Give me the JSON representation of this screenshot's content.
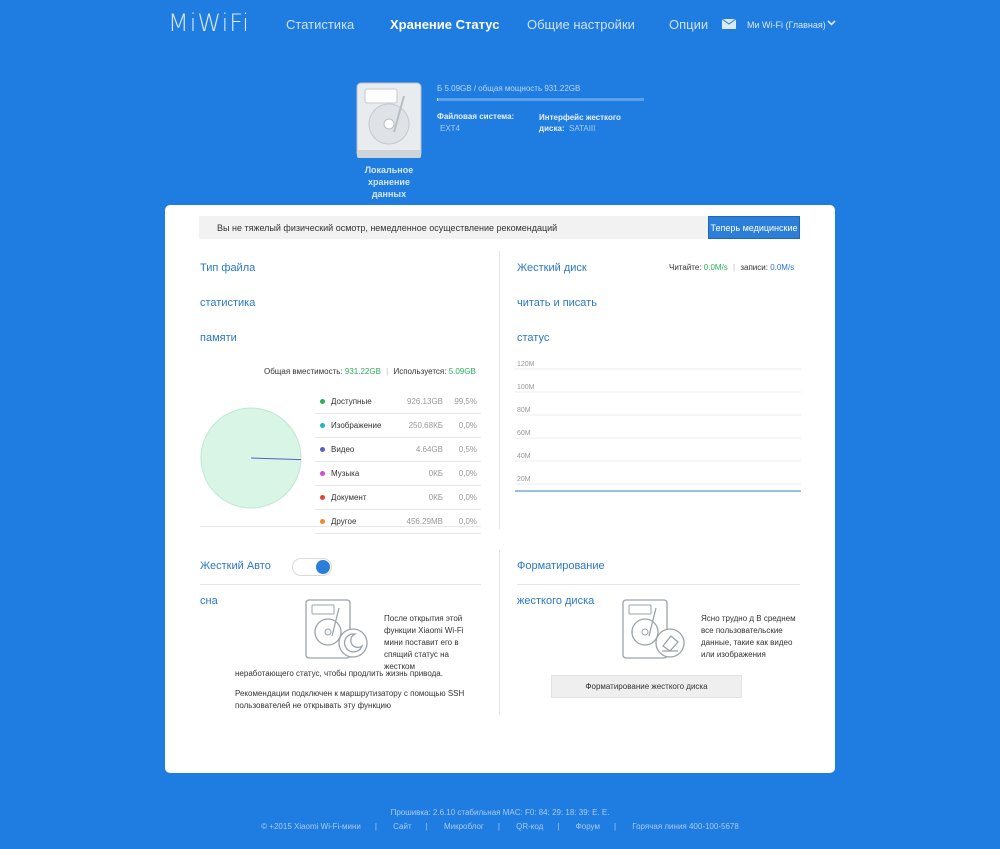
{
  "header": {
    "logo": "MiWiFi",
    "nav": [
      "Статистика",
      "Хранение Статус",
      "Общие настройки",
      "Опции"
    ],
    "active_nav": "Хранение Статус",
    "router_name": "Ми Wi-Fi (Главная)"
  },
  "disk": {
    "caption": "Локальное хранение данных",
    "usage_text": "Б 5.09GB / общая мощность 931.22GB",
    "usage_fraction": 0.005,
    "fs_label": "Файловая система:",
    "fs_value": "EXT4",
    "interface_label": "Интерфейс жесткого диска:",
    "interface_value": "SATAIII"
  },
  "alert": {
    "text": "Вы не тяжелый физический осмотр, немедленное осуществление рекомендаций",
    "button": "Теперь медицинские"
  },
  "file_type": {
    "title1": "Тип файла",
    "title2": "статистика",
    "title3": "памяти",
    "total_label": "Общая вместимость:",
    "total_value": "931.22GB",
    "used_label": "Используется:",
    "used_value": "5.09GB",
    "legend": [
      {
        "name": "Доступные",
        "size": "926.13GB",
        "pct": "99,5%",
        "color": "#28b25a"
      },
      {
        "name": "Изображение",
        "size": "250.68КБ",
        "pct": "0,0%",
        "color": "#1bb6c9"
      },
      {
        "name": "Видео",
        "size": "4.64GB",
        "pct": "0,5%",
        "color": "#5b5fc7"
      },
      {
        "name": "Музыка",
        "size": "0КБ",
        "pct": "0,0%",
        "color": "#d34bd3"
      },
      {
        "name": "Документ",
        "size": "0КБ",
        "pct": "0,0%",
        "color": "#e0453a"
      },
      {
        "name": "Другое",
        "size": "456.29MB",
        "pct": "0,0%",
        "color": "#f08a24"
      }
    ]
  },
  "disk_io": {
    "title1": "Жесткий диск",
    "title2": "читать и писать",
    "title3": "статус",
    "read_label": "Читайте:",
    "read_value": "0.0M/s",
    "write_label": "записи:",
    "write_value": "0.0M/s"
  },
  "chart_data": {
    "type": "line",
    "title": "",
    "y_ticks": [
      "120M",
      "100M",
      "80M",
      "60M",
      "40M",
      "20M"
    ],
    "ylim": [
      0,
      120
    ],
    "series": [
      {
        "values": [
          0,
          0,
          0,
          0,
          0,
          0,
          0,
          0,
          0,
          0
        ],
        "color": "#5b9bd5"
      }
    ],
    "grid": true
  },
  "sleep": {
    "title1": "Жесткий Авто",
    "title2": "сна",
    "toggle_on": true,
    "desc": "После открытия этой функции Xiaomi Wi-Fi мини поставит его в спящий статус на жестком",
    "desc2": "неработающего статус, чтобы продлить жизнь привода.",
    "note": "Рекомендации подключен к маршрутизатору с помощью SSH пользователей не открывать эту функцию"
  },
  "format": {
    "title1": "Форматирование",
    "title2": "жесткого диска",
    "desc": "Ясно трудно д В среднем все пользовательские данные, такие как видео или изображения",
    "button": "Форматирование жесткого диска"
  },
  "footer": {
    "line1": "Прошивка: 2.6.10 стабильная MAC: F0: 84: 29: 18: 39: E. E.",
    "copyright": "© +2015 Xiaomi Wi-Fi-мини",
    "links": [
      "Сайт",
      "Микроблог",
      "QR-код",
      "Форум",
      "Горячая линия 400-100-5678"
    ]
  }
}
